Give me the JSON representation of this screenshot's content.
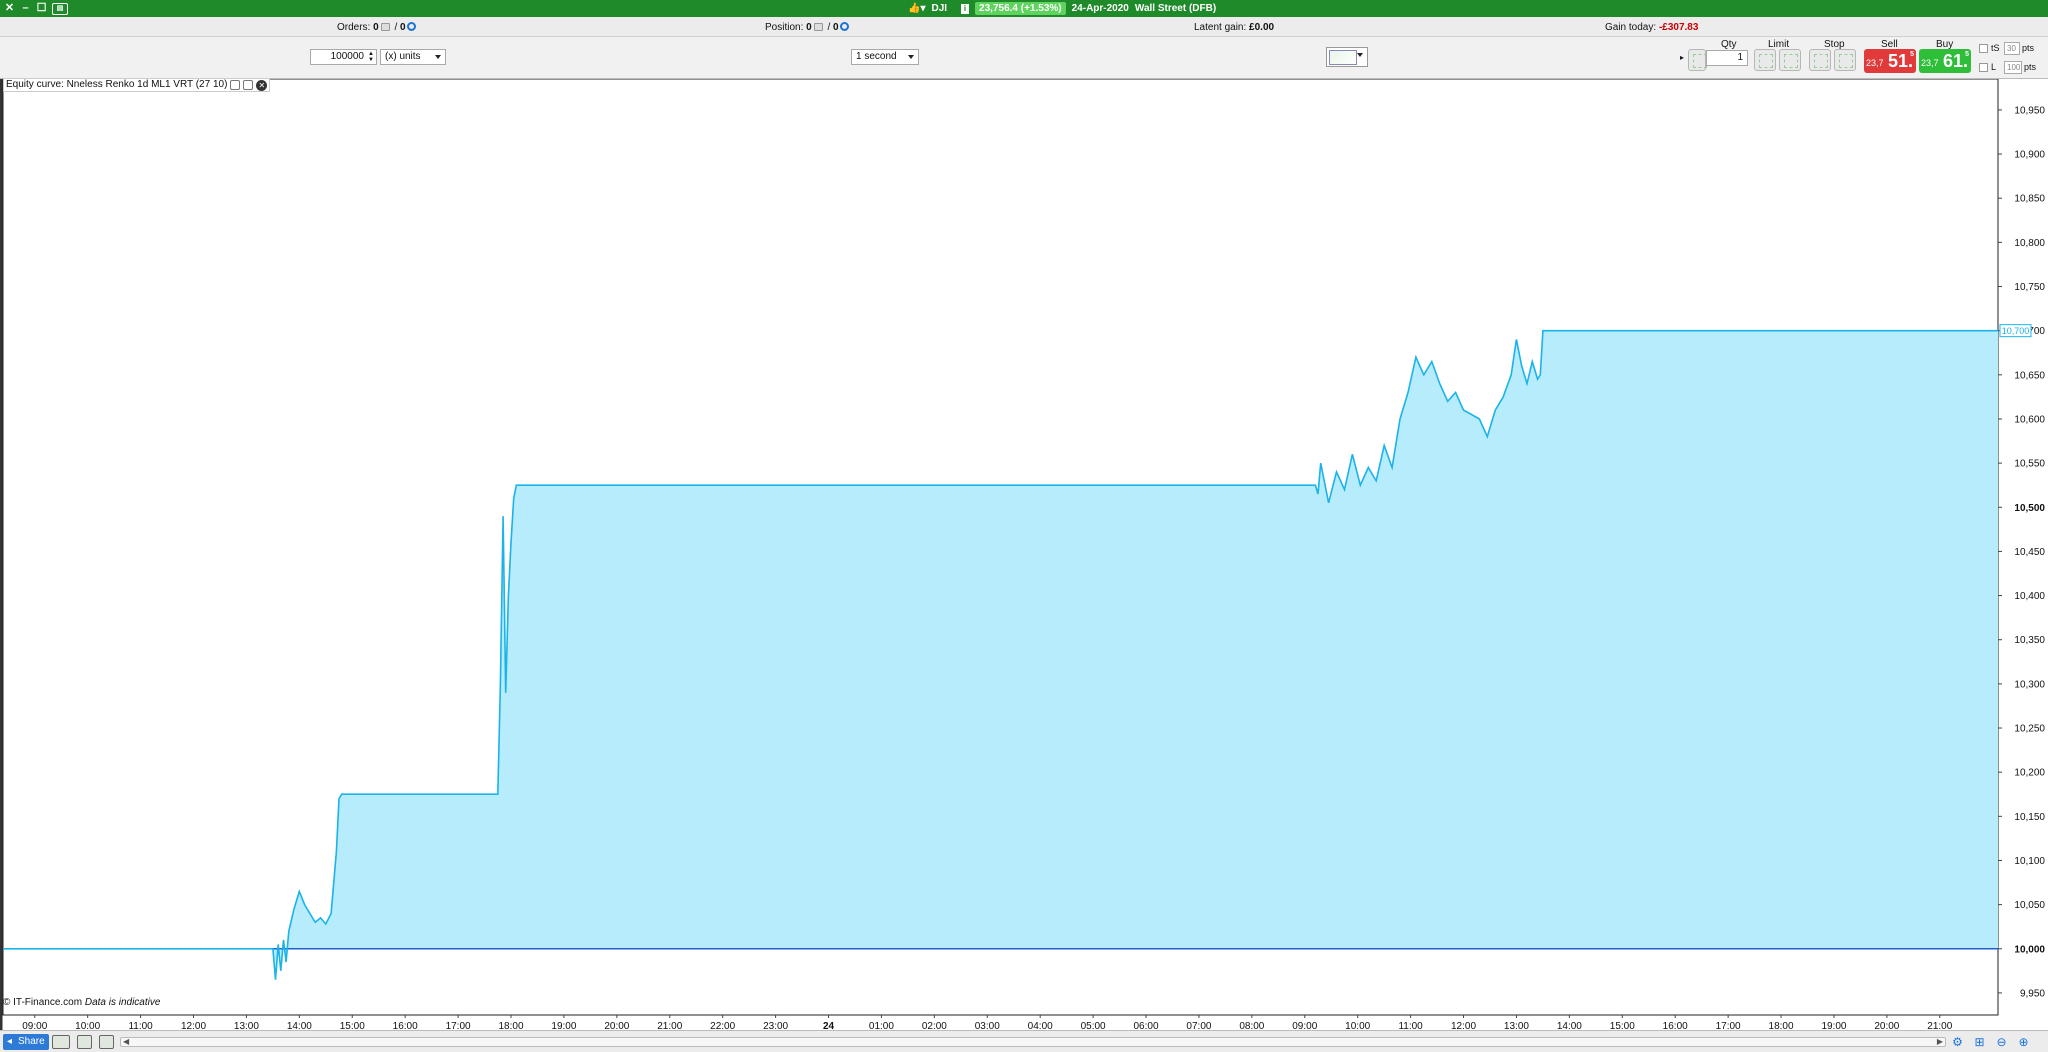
{
  "titlebar": {
    "instrument": "DJI",
    "price_badge": "23,756.4 (+1.53%)",
    "date": "24-Apr-2020",
    "market": "Wall Street (DFB)"
  },
  "infobar": {
    "orders_label": "Orders:",
    "orders_a": "0",
    "orders_b": "0",
    "position_label": "Position:",
    "position_a": "0",
    "position_b": "0",
    "latent_label": "Latent gain:",
    "latent_value": "£0.00",
    "gain_label": "Gain today:",
    "gain_value": "-£307.83"
  },
  "toolbar": {
    "quantity_value": "100000",
    "units_select": "(x) units",
    "timeframe_select": "1 second"
  },
  "deal": {
    "qty_label": "Qty",
    "qty_value": "1",
    "limit_label": "Limit",
    "stop_label": "Stop",
    "sell_label": "Sell",
    "buy_label": "Buy",
    "sell_small": "23,7",
    "sell_big": "51.",
    "sell_sup": "5",
    "buy_small": "23,7",
    "buy_big": "61.",
    "buy_sup": "5",
    "ts_label": "tS",
    "ts_value": "30",
    "ts_unit": "pts",
    "l_label": "L",
    "l_value": "100",
    "l_unit": "pts"
  },
  "study": {
    "label": "Equity curve: Nneless Renko 1d ML1 VRT (27 10)"
  },
  "footer": {
    "copyright": "© IT-Finance.com",
    "indicative": "Data is indicative",
    "share_label": "Share"
  },
  "colors": {
    "fill": "#b6ecfb",
    "line": "#1ab4ea",
    "baseline": "#1f5fd1",
    "noise": "#c77ad6",
    "titlebar": "#1f8a2a",
    "sell": "#e03a3a",
    "buy": "#2fbe3a"
  },
  "chart_data": {
    "type": "area",
    "title": "Equity curve: Nneless Renko 1d ML1 VRT (27 10)",
    "ylim": [
      9925,
      10985
    ],
    "y_ticks": [
      9950,
      10000,
      10050,
      10100,
      10150,
      10200,
      10250,
      10300,
      10350,
      10400,
      10450,
      10500,
      10550,
      10600,
      10650,
      10700,
      10750,
      10800,
      10850,
      10900,
      10950
    ],
    "y_tick_labels": [
      "9,950",
      "10,000",
      "10,050",
      "10,100",
      "10,150",
      "10,200",
      "10,250",
      "10,300",
      "10,350",
      "10,400",
      "10,450",
      "10,500",
      "10,550",
      "10,600",
      "10,650",
      "10,700",
      "10,750",
      "10,800",
      "10,850",
      "10,900",
      "10,950"
    ],
    "bold_ticks": [
      "10,000",
      "10,500"
    ],
    "current_value_label": "10,700",
    "x_labels": [
      "09:00",
      "10:00",
      "11:00",
      "12:00",
      "13:00",
      "14:00",
      "15:00",
      "16:00",
      "17:00",
      "18:00",
      "19:00",
      "20:00",
      "21:00",
      "22:00",
      "23:00",
      "24",
      "01:00",
      "02:00",
      "03:00",
      "04:00",
      "05:00",
      "06:00",
      "07:00",
      "08:00",
      "09:00",
      "10:00",
      "11:00",
      "12:00",
      "13:00",
      "14:00",
      "15:00",
      "16:00",
      "17:00",
      "18:00",
      "19:00",
      "20:00",
      "21:00"
    ],
    "x_hours_from_0900": [
      0,
      1,
      2,
      3,
      4,
      5,
      6,
      7,
      8,
      9,
      10,
      11,
      12,
      13,
      14,
      15,
      16,
      17,
      18,
      19,
      20,
      21,
      22,
      23,
      24,
      25,
      26,
      27,
      28,
      29,
      30,
      31,
      32,
      33,
      34,
      35,
      36
    ],
    "x_range_hours": [
      -0.6,
      37.1
    ],
    "baseline": 10000,
    "series": [
      {
        "name": "Equity",
        "points": [
          [
            -0.6,
            10000
          ],
          [
            4.5,
            10000
          ],
          [
            4.55,
            9965
          ],
          [
            4.6,
            10005
          ],
          [
            4.65,
            9975
          ],
          [
            4.7,
            10010
          ],
          [
            4.75,
            9985
          ],
          [
            4.8,
            10020
          ],
          [
            4.9,
            10045
          ],
          [
            5.0,
            10065
          ],
          [
            5.1,
            10050
          ],
          [
            5.2,
            10040
          ],
          [
            5.3,
            10030
          ],
          [
            5.4,
            10035
          ],
          [
            5.5,
            10028
          ],
          [
            5.6,
            10040
          ],
          [
            5.7,
            10110
          ],
          [
            5.75,
            10170
          ],
          [
            5.8,
            10175
          ],
          [
            8.75,
            10175
          ],
          [
            8.8,
            10300
          ],
          [
            8.85,
            10490
          ],
          [
            8.9,
            10290
          ],
          [
            8.95,
            10400
          ],
          [
            9.0,
            10460
          ],
          [
            9.05,
            10510
          ],
          [
            9.1,
            10525
          ],
          [
            24.2,
            10525
          ],
          [
            24.25,
            10515
          ],
          [
            24.3,
            10550
          ],
          [
            24.45,
            10505
          ],
          [
            24.6,
            10540
          ],
          [
            24.75,
            10520
          ],
          [
            24.9,
            10560
          ],
          [
            25.05,
            10525
          ],
          [
            25.2,
            10545
          ],
          [
            25.35,
            10530
          ],
          [
            25.5,
            10570
          ],
          [
            25.65,
            10545
          ],
          [
            25.8,
            10600
          ],
          [
            25.95,
            10630
          ],
          [
            26.1,
            10670
          ],
          [
            26.25,
            10650
          ],
          [
            26.4,
            10665
          ],
          [
            26.55,
            10640
          ],
          [
            26.7,
            10620
          ],
          [
            26.85,
            10630
          ],
          [
            27.0,
            10610
          ],
          [
            27.15,
            10605
          ],
          [
            27.3,
            10600
          ],
          [
            27.45,
            10580
          ],
          [
            27.6,
            10610
          ],
          [
            27.75,
            10625
          ],
          [
            27.9,
            10650
          ],
          [
            28.0,
            10690
          ],
          [
            28.1,
            10660
          ],
          [
            28.2,
            10640
          ],
          [
            28.3,
            10665
          ],
          [
            28.4,
            10645
          ],
          [
            28.45,
            10650
          ],
          [
            28.5,
            10700
          ],
          [
            37.1,
            10700
          ]
        ]
      }
    ]
  }
}
